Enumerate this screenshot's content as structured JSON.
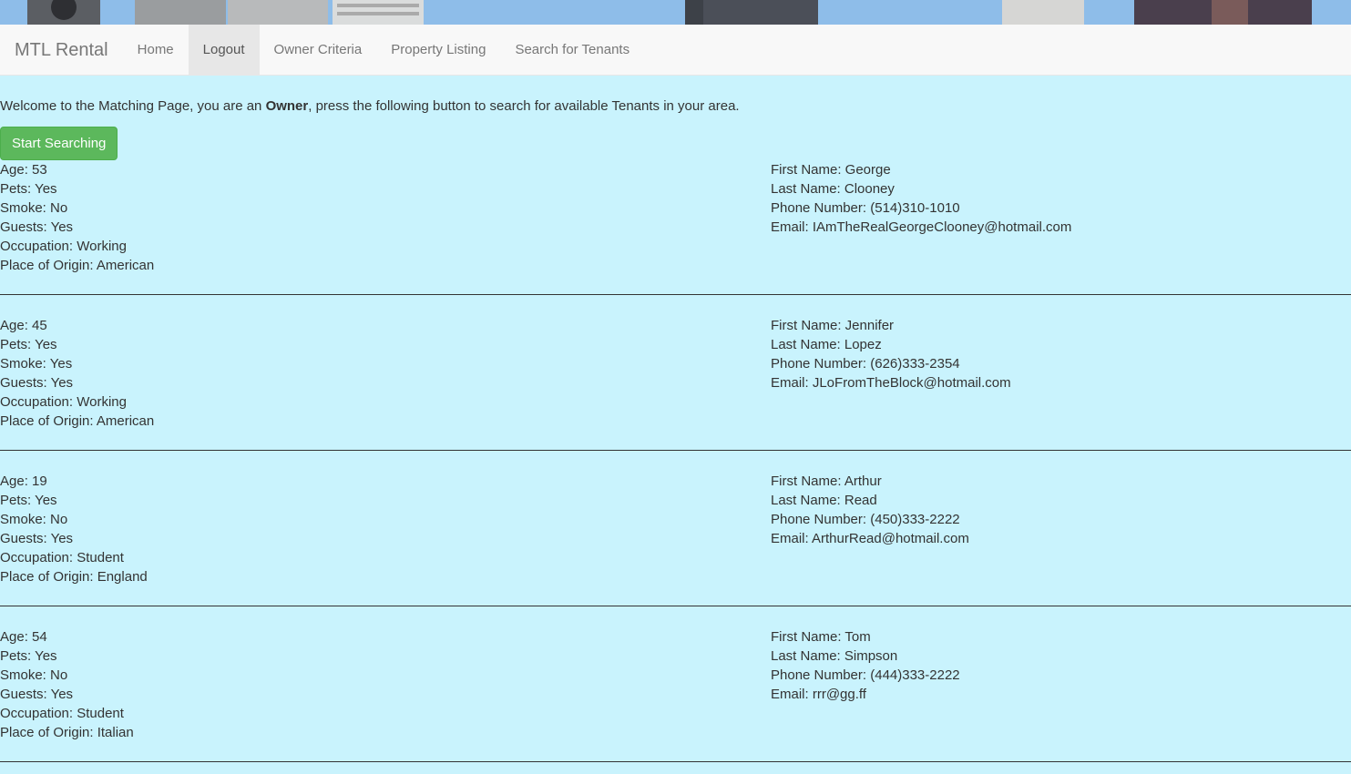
{
  "navbar": {
    "brand": "MTL Rental",
    "items": [
      "Home",
      "Logout",
      "Owner Criteria",
      "Property Listing",
      "Search for Tenants"
    ],
    "active_index": 1
  },
  "welcome": {
    "before": "Welcome to the Matching Page, you are an ",
    "role": "Owner",
    "after": ", press the following button to search for available Tenants in your area."
  },
  "start_button": "Start Searching",
  "tenants": [
    {
      "age": "Age: 53",
      "pets": "Pets: Yes",
      "smoke": "Smoke: No",
      "guests": "Guests: Yes",
      "occupation": "Occupation: Working",
      "origin": "Place of Origin: American",
      "first_name": "First Name: George",
      "last_name": "Last Name: Clooney",
      "phone": "Phone Number: (514)310-1010",
      "email": "Email: IAmTheRealGeorgeClooney@hotmail.com"
    },
    {
      "age": "Age: 45",
      "pets": "Pets: Yes",
      "smoke": "Smoke: Yes",
      "guests": "Guests: Yes",
      "occupation": "Occupation: Working",
      "origin": "Place of Origin: American",
      "first_name": "First Name: Jennifer",
      "last_name": "Last Name: Lopez",
      "phone": "Phone Number: (626)333-2354",
      "email": "Email: JLoFromTheBlock@hotmail.com"
    },
    {
      "age": "Age: 19",
      "pets": "Pets: Yes",
      "smoke": "Smoke: No",
      "guests": "Guests: Yes",
      "occupation": "Occupation: Student",
      "origin": "Place of Origin: England",
      "first_name": "First Name: Arthur",
      "last_name": "Last Name: Read",
      "phone": "Phone Number: (450)333-2222",
      "email": "Email: ArthurRead@hotmail.com"
    },
    {
      "age": "Age: 54",
      "pets": "Pets: Yes",
      "smoke": "Smoke: No",
      "guests": "Guests: Yes",
      "occupation": "Occupation: Student",
      "origin": "Place of Origin: Italian",
      "first_name": "First Name: Tom",
      "last_name": "Last Name: Simpson",
      "phone": "Phone Number: (444)333-2222",
      "email": "Email: rrr@gg.ff"
    }
  ],
  "colors": {
    "page_bg": "#c9f3fd",
    "navbar_bg": "#f8f8f8",
    "button_green": "#5cb85c"
  }
}
